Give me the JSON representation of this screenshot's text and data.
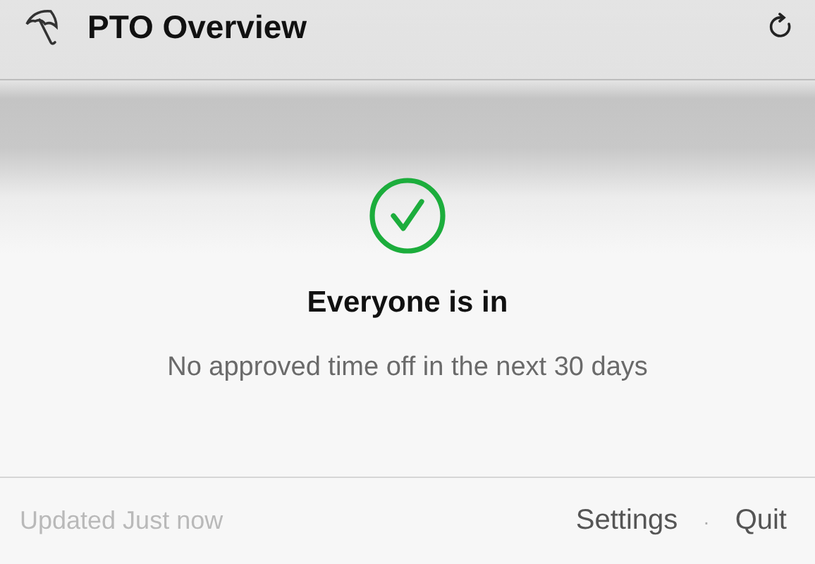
{
  "header": {
    "title": "PTO Overview"
  },
  "status": {
    "title": "Everyone is in",
    "message": "No approved time off in the next 30 days"
  },
  "footer": {
    "updated": "Updated Just now",
    "links": [
      "Settings",
      "Quit"
    ],
    "separator": "·"
  }
}
